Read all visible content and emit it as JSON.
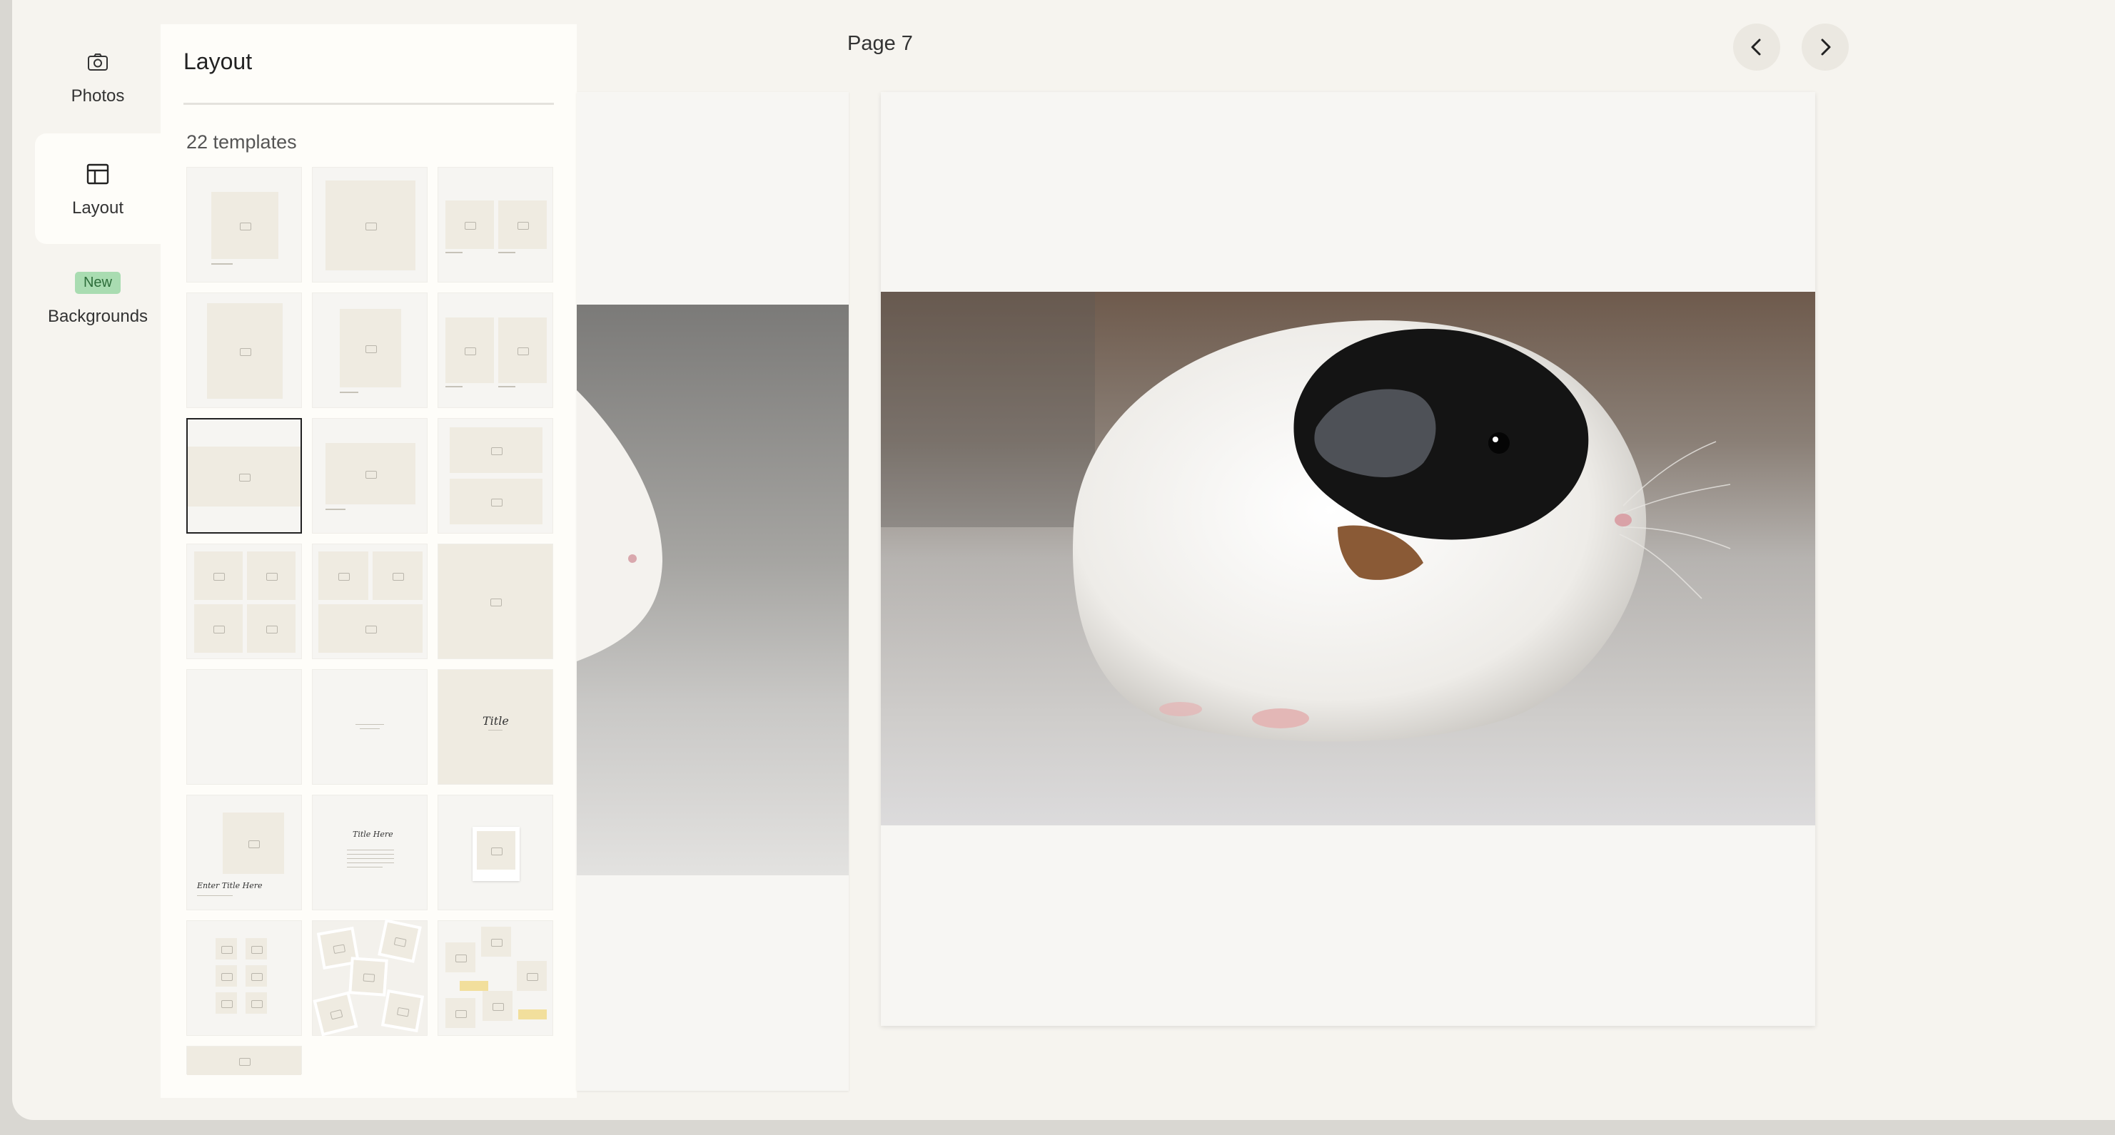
{
  "rail": {
    "photos_label": "Photos",
    "layout_label": "Layout",
    "new_badge": "New",
    "backgrounds_label": "Backgrounds"
  },
  "panel": {
    "title": "Layout",
    "count": "22 templates",
    "selected_template_index": 6,
    "template_texts": {
      "title_script": "Title",
      "enter_title": "Enter Title Here",
      "title_here": "Title Here"
    }
  },
  "header": {
    "page_label": "Page 7"
  },
  "icons": {
    "photos": "camera-icon",
    "layout": "layout-icon",
    "prev": "chevron-left-icon",
    "next": "chevron-right-icon"
  },
  "colors": {
    "app_bg": "#f6f4ef",
    "panel_bg": "#fefdf9",
    "badge_bg": "#a9dcb1",
    "placeholder": "#efebe1"
  }
}
